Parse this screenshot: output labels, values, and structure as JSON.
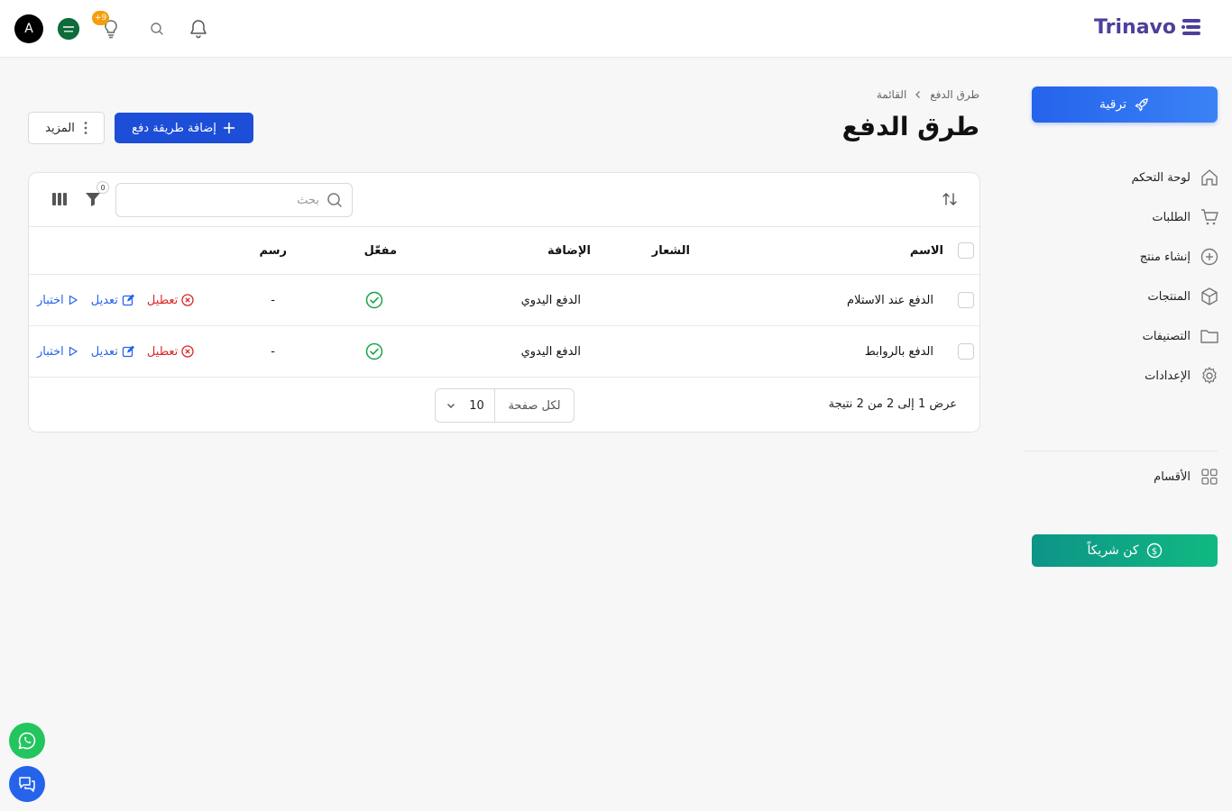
{
  "header": {
    "logo_text": "Trinavo",
    "avatar_letter": "A",
    "notification_badge": "+9",
    "icons": [
      "bell-icon",
      "search-icon",
      "bulb-icon",
      "flag-icon"
    ]
  },
  "sidebar": {
    "upgrade_label": "ترقية",
    "items": [
      {
        "label": "لوحة التحكم",
        "icon": "home-icon"
      },
      {
        "label": "الطلبات",
        "icon": "cart-icon"
      },
      {
        "label": "إنشاء منتج",
        "icon": "plus-circle-icon"
      },
      {
        "label": "المنتجات",
        "icon": "box-icon"
      },
      {
        "label": "التصنيفات",
        "icon": "folder-icon"
      },
      {
        "label": "الإعدادات",
        "icon": "gear-icon"
      }
    ],
    "sections_label": "الأقسام",
    "partner_label": "كن شريكاً"
  },
  "breadcrumb": {
    "list": "القائمة",
    "current": "طرق الدفع"
  },
  "page": {
    "title": "طرق الدفع",
    "add_label": "إضافة طريقة دفع",
    "more_label": "المزيد"
  },
  "table": {
    "search_placeholder": "بحث",
    "filter_count": "0",
    "columns": {
      "name": "الاسم",
      "logo": "الشعار",
      "addon": "الإضافة",
      "enabled": "مفعّل",
      "fee": "رسم"
    },
    "rows": [
      {
        "name": "الدفع عند الاستلام",
        "logo": "",
        "addon": "الدفع اليدوي",
        "enabled": true,
        "fee": "-"
      },
      {
        "name": "الدفع بالروابط",
        "logo": "",
        "addon": "الدفع اليدوي",
        "enabled": true,
        "fee": "-"
      }
    ],
    "actions": {
      "disable": "تعطيل",
      "edit": "تعديل",
      "test": "اختبار"
    },
    "footer": {
      "result_text": "عرض 1 إلى 2 من 2 نتيجة",
      "per_page_label": "لكل صفحة",
      "per_page_value": "10"
    }
  },
  "colors": {
    "primary": "#1d4ed8",
    "danger": "#dc2626",
    "success": "#16a34a",
    "partner": "#10b981",
    "logo": "#4d3f9a"
  }
}
